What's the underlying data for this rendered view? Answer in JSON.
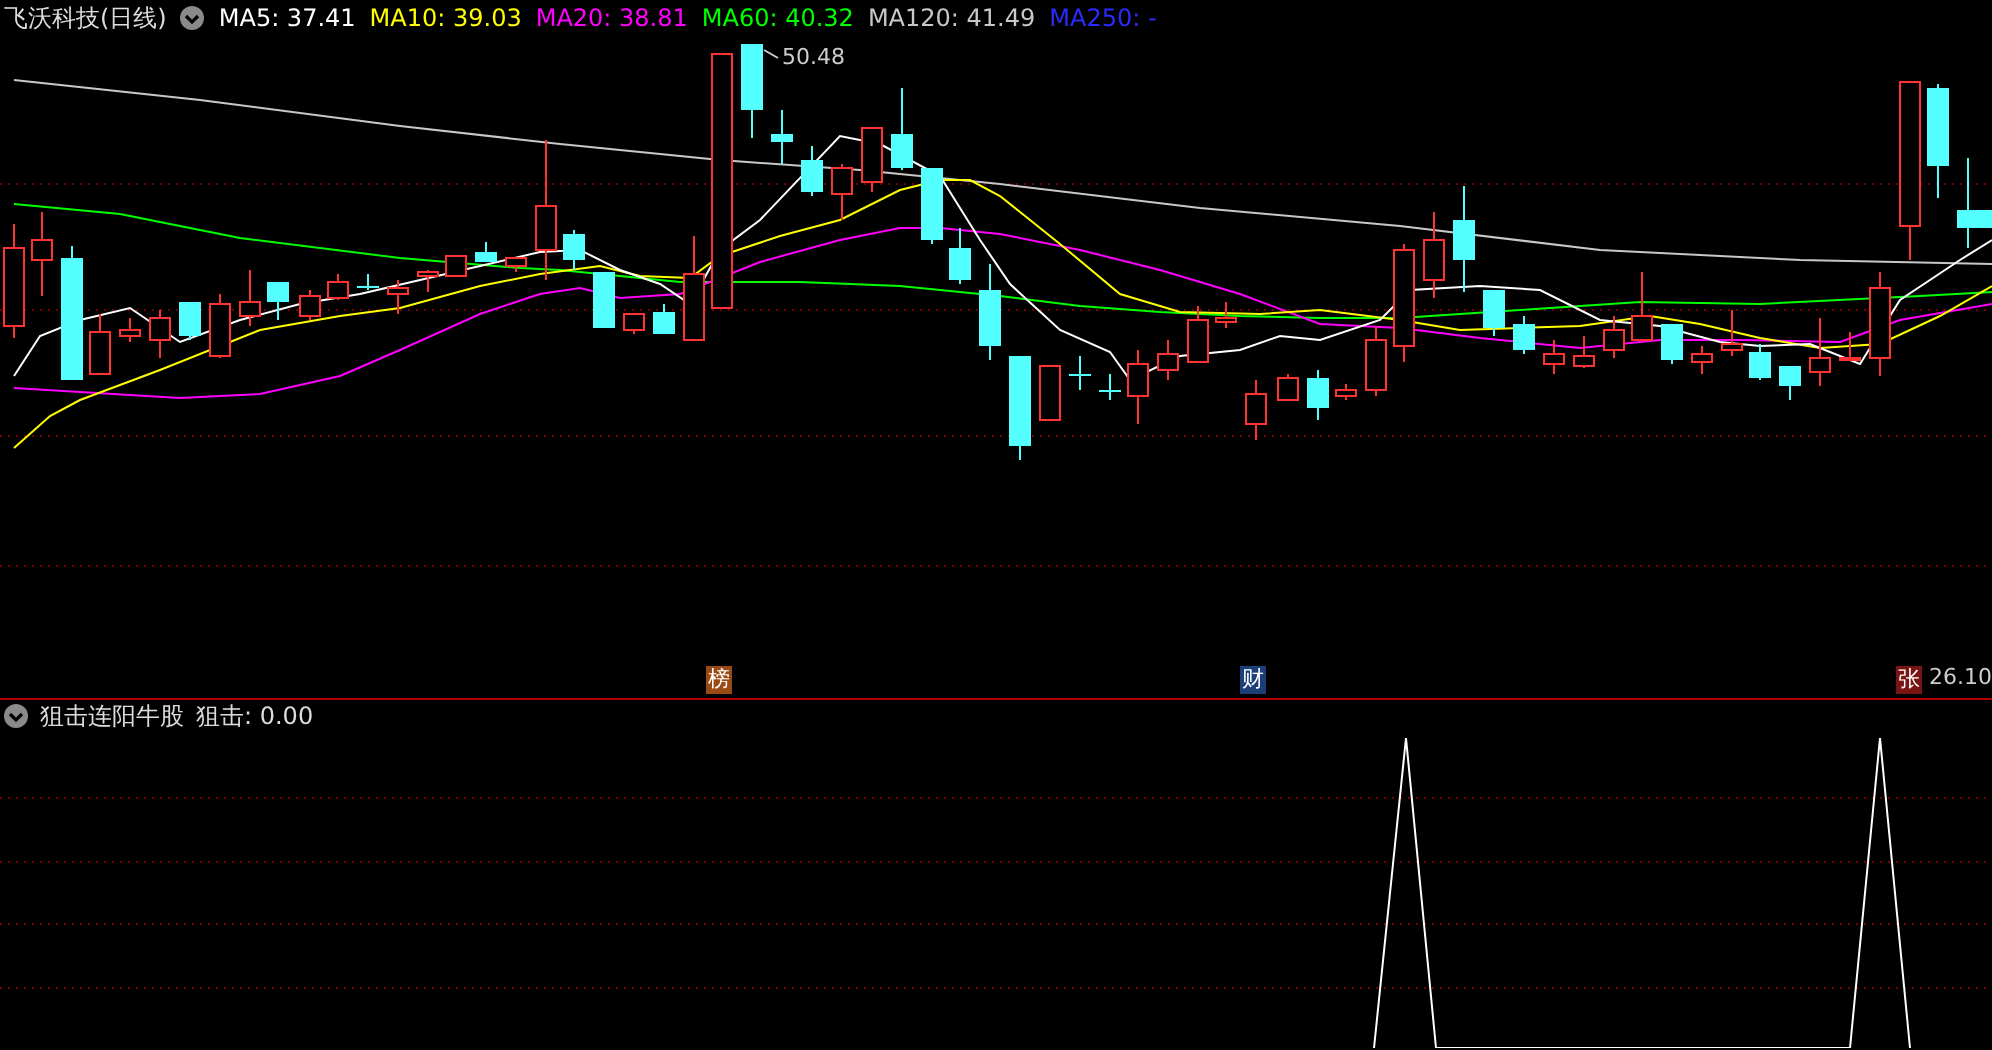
{
  "header": {
    "title": "飞沃科技(日线)",
    "indicators": [
      {
        "label": "MA5: 37.41",
        "color": "#ffffff"
      },
      {
        "label": "MA10: 39.03",
        "color": "#ffff00"
      },
      {
        "label": "MA20: 38.81",
        "color": "#ff00ff"
      },
      {
        "label": "MA60: 40.32",
        "color": "#00ff00"
      },
      {
        "label": "MA120: 41.49",
        "color": "#c8c8c8"
      },
      {
        "label": "MA250: -",
        "color": "#2b2bff"
      }
    ]
  },
  "chart": {
    "high_label": "50.48",
    "low_label": "26.10",
    "markers": [
      {
        "text": "榜",
        "color": "#9a4a14"
      },
      {
        "text": "财",
        "color": "#1c3f78"
      },
      {
        "text": "张",
        "color": "#7a1414"
      }
    ]
  },
  "lower_panel": {
    "title": "狙击连阳牛股",
    "reading": "狙击: 0.00"
  }
}
